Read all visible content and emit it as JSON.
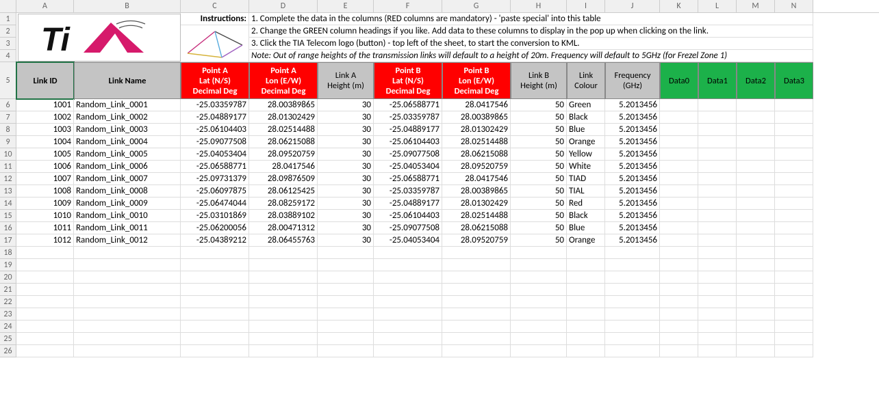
{
  "cols": [
    "A",
    "B",
    "C",
    "D",
    "E",
    "F",
    "G",
    "H",
    "I",
    "J",
    "K",
    "L",
    "M",
    "N"
  ],
  "row_labels": [
    "1",
    "2",
    "3",
    "4",
    "5",
    "6",
    "7",
    "8",
    "9",
    "10",
    "11",
    "12",
    "13",
    "14",
    "15",
    "16",
    "17",
    "18",
    "19",
    "20",
    "21",
    "22",
    "23",
    "24",
    "25",
    "26"
  ],
  "instructions_label": "Instructions:",
  "instr1": "1. Complete the data in the columns (RED columns are mandatory) - 'paste special' into this table",
  "instr2": "2. Change the GREEN column headings if you like. Add data to these columns to display in the pop up when clicking on the link.",
  "instr3": "3. Click the TIA Telecom logo (button) - top left of the sheet, to start the conversion to KML.",
  "note": "Note: Out of range heights of the transmission links will default to a height of 20m. Frequency will default to 5GHz (for Frezel Zone 1)",
  "headers": {
    "link_id": "Link ID",
    "link_name": "Link Name",
    "pa_lat1": "Point A",
    "pa_lat2": "Lat (N/S)",
    "pa_lat3": "Decimal Deg",
    "pa_lon1": "Point A",
    "pa_lon2": "Lon (E/W)",
    "pa_lon3": "Decimal Deg",
    "la_h1": "Link A",
    "la_h2": "Height (m)",
    "pb_lat1": "Point B",
    "pb_lat2": "Lat (N/S)",
    "pb_lat3": "Decimal Deg",
    "pb_lon1": "Point B",
    "pb_lon2": "Lon (E/W)",
    "pb_lon3": "Decimal Deg",
    "lb_h1": "Link B",
    "lb_h2": "Height (m)",
    "lc1": "Link",
    "lc2": "Colour",
    "fq1": "Frequency",
    "fq2": "(GHz)",
    "d0": "Data0",
    "d1": "Data1",
    "d2": "Data2",
    "d3": "Data3"
  },
  "rows": [
    {
      "id": "1001",
      "name": "Random_Link_0001",
      "alat": "-25.03359787",
      "alon": "28.00389865",
      "ah": "30",
      "blat": "-25.06588771",
      "blon": "28.0417546",
      "bh": "50",
      "col": "Green",
      "freq": "5.2013456"
    },
    {
      "id": "1002",
      "name": "Random_Link_0002",
      "alat": "-25.04889177",
      "alon": "28.01302429",
      "ah": "30",
      "blat": "-25.03359787",
      "blon": "28.00389865",
      "bh": "50",
      "col": "Black",
      "freq": "5.2013456"
    },
    {
      "id": "1003",
      "name": "Random_Link_0003",
      "alat": "-25.06104403",
      "alon": "28.02514488",
      "ah": "30",
      "blat": "-25.04889177",
      "blon": "28.01302429",
      "bh": "50",
      "col": "Blue",
      "freq": "5.2013456"
    },
    {
      "id": "1004",
      "name": "Random_Link_0004",
      "alat": "-25.09077508",
      "alon": "28.06215088",
      "ah": "30",
      "blat": "-25.06104403",
      "blon": "28.02514488",
      "bh": "50",
      "col": "Orange",
      "freq": "5.2013456"
    },
    {
      "id": "1005",
      "name": "Random_Link_0005",
      "alat": "-25.04053404",
      "alon": "28.09520759",
      "ah": "30",
      "blat": "-25.09077508",
      "blon": "28.06215088",
      "bh": "50",
      "col": "Yellow",
      "freq": "5.2013456"
    },
    {
      "id": "1006",
      "name": "Random_Link_0006",
      "alat": "-25.06588771",
      "alon": "28.0417546",
      "ah": "30",
      "blat": "-25.04053404",
      "blon": "28.09520759",
      "bh": "50",
      "col": "White",
      "freq": "5.2013456"
    },
    {
      "id": "1007",
      "name": "Random_Link_0007",
      "alat": "-25.09731379",
      "alon": "28.09876509",
      "ah": "30",
      "blat": "-25.06588771",
      "blon": "28.0417546",
      "bh": "50",
      "col": "TIAD",
      "freq": "5.2013456"
    },
    {
      "id": "1008",
      "name": "Random_Link_0008",
      "alat": "-25.06097875",
      "alon": "28.06125425",
      "ah": "30",
      "blat": "-25.03359787",
      "blon": "28.00389865",
      "bh": "50",
      "col": "TIAL",
      "freq": "5.2013456"
    },
    {
      "id": "1009",
      "name": "Random_Link_0009",
      "alat": "-25.06474044",
      "alon": "28.08259172",
      "ah": "30",
      "blat": "-25.04889177",
      "blon": "28.01302429",
      "bh": "50",
      "col": "Red",
      "freq": "5.2013456"
    },
    {
      "id": "1010",
      "name": "Random_Link_0010",
      "alat": "-25.03101869",
      "alon": "28.03889102",
      "ah": "30",
      "blat": "-25.06104403",
      "blon": "28.02514488",
      "bh": "50",
      "col": "Black",
      "freq": "5.2013456"
    },
    {
      "id": "1011",
      "name": "Random_Link_0011",
      "alat": "-25.06200056",
      "alon": "28.00471312",
      "ah": "30",
      "blat": "-25.09077508",
      "blon": "28.06215088",
      "bh": "50",
      "col": "Blue",
      "freq": "5.2013456"
    },
    {
      "id": "1012",
      "name": "Random_Link_0012",
      "alat": "-25.04389212",
      "alon": "28.06455763",
      "ah": "30",
      "blat": "-25.04053404",
      "blon": "28.09520759",
      "bh": "50",
      "col": "Orange",
      "freq": "5.2013456"
    }
  ]
}
